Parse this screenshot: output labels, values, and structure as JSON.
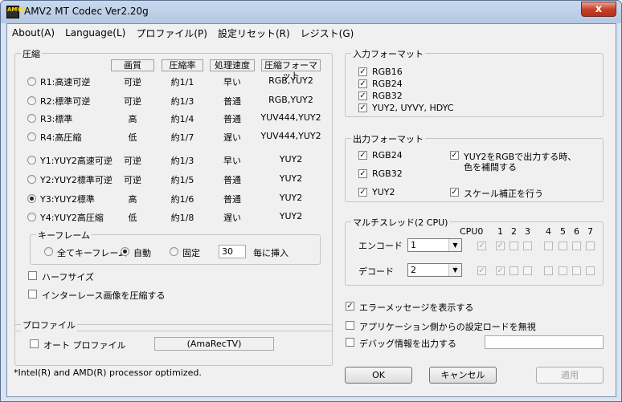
{
  "window": {
    "title": "AMV2 MT Codec Ver2.20g",
    "close": "x",
    "icon_text": "AMV2"
  },
  "menu": [
    "About(A)",
    "Language(L)",
    "プロファイル(P)",
    "設定リセット(R)",
    "レジスト(G)"
  ],
  "compression": {
    "group_label": "圧縮",
    "headers": [
      "画質",
      "圧縮率",
      "処理速度",
      "圧縮フォーマット"
    ],
    "rows": [
      {
        "label": "R1:高速可逆",
        "quality": "可逆",
        "ratio": "約1/1",
        "speed": "早い",
        "format": "RGB,YUY2"
      },
      {
        "label": "R2:標準可逆",
        "quality": "可逆",
        "ratio": "約1/3",
        "speed": "普通",
        "format": "RGB,YUY2"
      },
      {
        "label": "R3:標準",
        "quality": "高",
        "ratio": "約1/4",
        "speed": "普通",
        "format": "YUV444,YUY2"
      },
      {
        "label": "R4:高圧縮",
        "quality": "低",
        "ratio": "約1/7",
        "speed": "遅い",
        "format": "YUV444,YUY2"
      },
      {
        "label": "Y1:YUY2高速可逆",
        "quality": "可逆",
        "ratio": "約1/3",
        "speed": "早い",
        "format": "YUY2"
      },
      {
        "label": "Y2:YUY2標準可逆",
        "quality": "可逆",
        "ratio": "約1/5",
        "speed": "普通",
        "format": "YUY2"
      },
      {
        "label": "Y3:YUY2標準",
        "quality": "高",
        "ratio": "約1/6",
        "speed": "普通",
        "format": "YUY2"
      },
      {
        "label": "Y4:YUY2高圧縮",
        "quality": "低",
        "ratio": "約1/8",
        "speed": "遅い",
        "format": "YUY2"
      }
    ],
    "selected_row": 6,
    "keyframe": {
      "group_label": "キーフレーム",
      "all_label": "全てキーフレーム",
      "auto_label": "自動",
      "fixed_label": "固定",
      "interval": "30",
      "suffix": "毎に挿入",
      "selected": "自動"
    },
    "half_size": {
      "label": "ハーフサイズ",
      "checked": false
    },
    "interlace": {
      "label": "インターレース画像を圧縮する",
      "checked": false
    }
  },
  "profile": {
    "group_label": "プロファイル",
    "auto_label": "オート プロファイル",
    "checked": false,
    "value": "(AmaRecTV)"
  },
  "footer_note": "*Intel(R) and AMD(R) processor optimized.",
  "input_format": {
    "group_label": "入力フォーマット",
    "items": [
      {
        "label": "RGB16",
        "checked": true
      },
      {
        "label": "RGB24",
        "checked": true
      },
      {
        "label": "RGB32",
        "checked": true
      },
      {
        "label": "YUY2, UYVY, HDYC",
        "checked": true
      }
    ]
  },
  "output_format": {
    "group_label": "出力フォーマット",
    "rgb24": "RGB24",
    "rgb32": "RGB32",
    "yuy2": "YUY2",
    "yuy2_to_rgb": "YUY2をRGBで出力する時、",
    "yuy2_to_rgb_2": "色を補間する",
    "scale": "スケール補正を行う"
  },
  "multithread": {
    "group_label": "マルチスレッド(2 CPU)",
    "cpu_labels": [
      "CPU0",
      "1",
      "2",
      "3",
      "4",
      "5",
      "6",
      "7"
    ],
    "encode_label": "エンコード",
    "decode_label": "デコード",
    "encode_value": "1",
    "decode_value": "2"
  },
  "options": {
    "error_msg": "エラーメッセージを表示する",
    "error_checked": true,
    "ignore_app": "アプリケーション側からの設定ロードを無視",
    "debug": "デバッグ情報を出力する",
    "debug_path": ""
  },
  "buttons": {
    "ok": "OK",
    "cancel": "キャンセル",
    "apply": "適用"
  }
}
